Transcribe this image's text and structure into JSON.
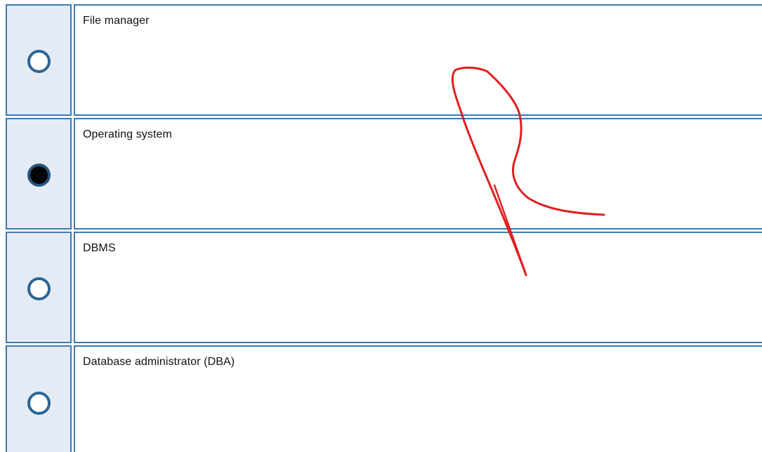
{
  "question": {
    "options": [
      {
        "label": "File manager",
        "selected": false,
        "icon": "radio-unchecked-icon"
      },
      {
        "label": "Operating system",
        "selected": true,
        "icon": "radio-checked-icon"
      },
      {
        "label": "DBMS",
        "selected": false,
        "icon": "radio-unchecked-icon"
      },
      {
        "label": "Database administrator (DBA)",
        "selected": false,
        "icon": "radio-unchecked-icon"
      }
    ]
  },
  "colors": {
    "cell_border": "#3a7ab0",
    "radio_cell_background": "#e5ebf5",
    "radio_ring": "#2c6596",
    "radio_fill_selected": "#050505",
    "annotation_ink": "#e01f1f"
  },
  "annotation": {
    "kind": "handwritten-mark",
    "icon": "red-ink-scribble"
  }
}
